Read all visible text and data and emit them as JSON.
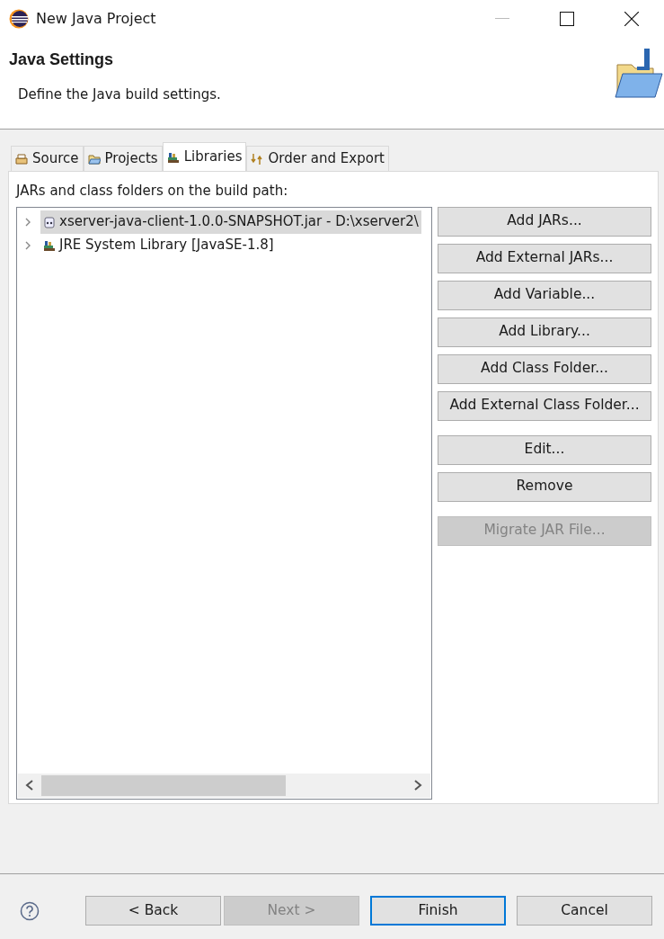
{
  "window": {
    "title": "New Java Project"
  },
  "header": {
    "title": "Java Settings",
    "description": "Define the Java build settings."
  },
  "tabs": [
    {
      "label": "Source",
      "kind": "source",
      "selected": false
    },
    {
      "label": "Projects",
      "kind": "projects",
      "selected": false
    },
    {
      "label": "Libraries",
      "kind": "libraries",
      "selected": true
    },
    {
      "label": "Order and Export",
      "kind": "order",
      "selected": false
    }
  ],
  "build_path": {
    "label": "JARs and class folders on the build path:",
    "items": [
      {
        "label": "xserver-java-client-1.0.0-SNAPSHOT.jar - D:\\xserver2\\",
        "kind": "jar",
        "expanded": false,
        "selected": true
      },
      {
        "label": "JRE System Library [JavaSE-1.8]",
        "kind": "library",
        "expanded": false,
        "selected": false
      }
    ]
  },
  "button_groups": [
    [
      {
        "label": "Add JARs...",
        "disabled": false
      },
      {
        "label": "Add External JARs...",
        "disabled": false
      },
      {
        "label": "Add Variable...",
        "disabled": false
      },
      {
        "label": "Add Library...",
        "disabled": false
      },
      {
        "label": "Add Class Folder...",
        "disabled": false
      },
      {
        "label": "Add External Class Folder...",
        "disabled": false
      }
    ],
    [
      {
        "label": "Edit...",
        "disabled": false
      },
      {
        "label": "Remove",
        "disabled": false
      }
    ],
    [
      {
        "label": "Migrate JAR File...",
        "disabled": true
      }
    ]
  ],
  "footer_buttons": [
    {
      "label": "< Back",
      "disabled": false,
      "default": false
    },
    {
      "label": "Next >",
      "disabled": true,
      "default": false
    },
    {
      "label": "Finish",
      "disabled": false,
      "default": true
    },
    {
      "label": "Cancel",
      "disabled": false,
      "default": false
    }
  ]
}
